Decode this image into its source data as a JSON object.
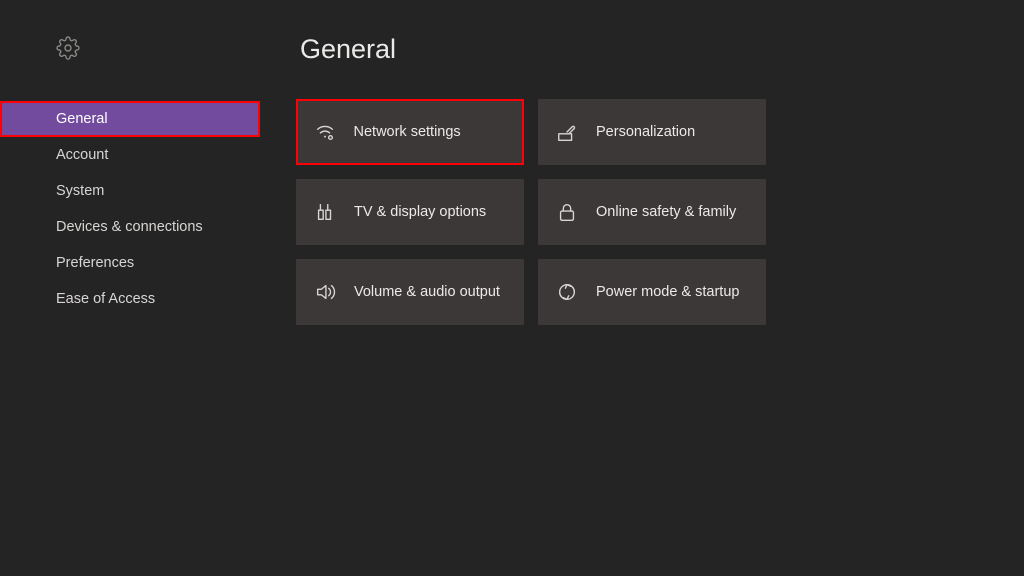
{
  "page_title": "General",
  "sidebar": {
    "items": [
      {
        "label": "General",
        "selected": true
      },
      {
        "label": "Account",
        "selected": false
      },
      {
        "label": "System",
        "selected": false
      },
      {
        "label": "Devices & connections",
        "selected": false
      },
      {
        "label": "Preferences",
        "selected": false
      },
      {
        "label": "Ease of Access",
        "selected": false
      }
    ]
  },
  "tiles": [
    {
      "label": "Network settings",
      "icon": "network-icon",
      "highlight": true
    },
    {
      "label": "Personalization",
      "icon": "personalize-icon",
      "highlight": false
    },
    {
      "label": "TV & display options",
      "icon": "display-icon",
      "highlight": false
    },
    {
      "label": "Online safety & family",
      "icon": "lock-icon",
      "highlight": false
    },
    {
      "label": "Volume & audio output",
      "icon": "volume-icon",
      "highlight": false
    },
    {
      "label": "Power mode & startup",
      "icon": "power-icon",
      "highlight": false
    }
  ]
}
